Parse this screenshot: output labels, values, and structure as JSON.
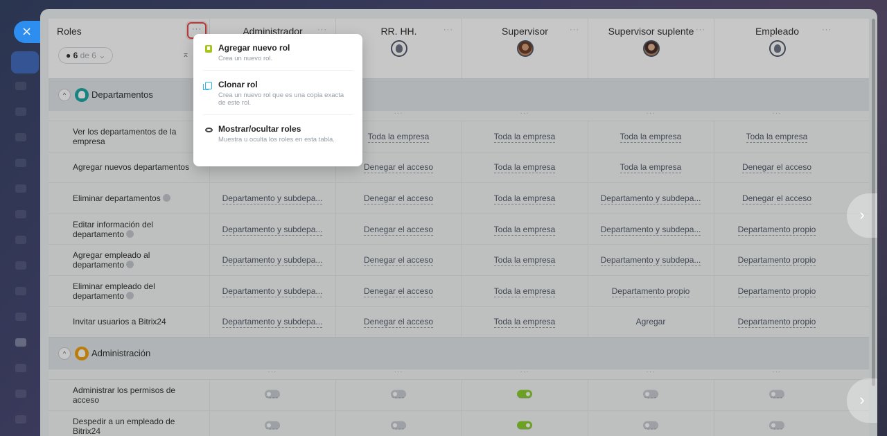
{
  "close_icon_glyph": "×",
  "roles_panel": {
    "title": "Roles",
    "menu_glyph": "···",
    "visible_count": "6",
    "visible_of": "de 6",
    "chevron_glyph": "⌄",
    "collapse_glyph": "⌅"
  },
  "roles": [
    {
      "name": "Administrador",
      "avatar": "none"
    },
    {
      "name": "RR. HH.",
      "avatar": "placeholder"
    },
    {
      "name": "Supervisor",
      "avatar": "photo"
    },
    {
      "name": "Supervisor suplente",
      "avatar": "photo"
    },
    {
      "name": "Empleado",
      "avatar": "group"
    }
  ],
  "role_menu_glyph": "···",
  "sections": [
    {
      "title": "Departamentos",
      "icon": "department-icon",
      "rows": [
        {
          "label": "Ver los departamentos de la empresa",
          "help": false,
          "values": [
            "",
            "Toda la empresa",
            "Toda la empresa",
            "Toda la empresa",
            "Toda la empresa"
          ]
        },
        {
          "label": "Agregar nuevos departamentos",
          "help": false,
          "values": [
            "",
            "Denegar el acceso",
            "Toda la empresa",
            "Toda la empresa",
            "Denegar el acceso"
          ]
        },
        {
          "label": "Eliminar departamentos",
          "help": true,
          "values": [
            "Departamento y subdepa...",
            "Denegar el acceso",
            "Toda la empresa",
            "Departamento y subdepa...",
            "Denegar el acceso"
          ]
        },
        {
          "label": "Editar información del departamento",
          "help": true,
          "values": [
            "Departamento y subdepa...",
            "Denegar el acceso",
            "Toda la empresa",
            "Departamento y subdepa...",
            "Departamento propio"
          ]
        },
        {
          "label": "Agregar empleado al departamento",
          "help": true,
          "values": [
            "Departamento y subdepa...",
            "Denegar el acceso",
            "Toda la empresa",
            "Departamento y subdepa...",
            "Departamento propio"
          ]
        },
        {
          "label": "Eliminar empleado del departamento",
          "help": true,
          "values": [
            "Departamento y subdepa...",
            "Denegar el acceso",
            "Toda la empresa",
            "Departamento propio",
            "Departamento propio"
          ]
        },
        {
          "label": "Invitar usuarios a Bitrix24",
          "help": false,
          "values": [
            "Departamento y subdepa...",
            "Denegar el acceso",
            "Toda la empresa",
            "Agregar",
            "Departamento propio"
          ]
        }
      ]
    },
    {
      "title": "Administración",
      "icon": "admin-icon",
      "rows": [
        {
          "label": "Administrar los permisos de acceso",
          "help": false,
          "toggles": [
            false,
            false,
            true,
            false,
            false
          ]
        },
        {
          "label": "Despedir a un empleado de Bitrix24",
          "help": false,
          "toggles": [
            false,
            false,
            true,
            false,
            false
          ]
        }
      ]
    }
  ],
  "next_arrow_glyph": "›",
  "popup": {
    "items": [
      {
        "title": "Agregar nuevo rol",
        "desc": "Crea un nuevo rol.",
        "icon": "book-icon"
      },
      {
        "title": "Clonar rol",
        "desc": "Crea un nuevo rol que es una copia exacta de este rol.",
        "icon": "copy-icon"
      },
      {
        "title": "Mostrar/ocultar roles",
        "desc": "Muestra u oculta los roles en esta tabla.",
        "icon": "eye-icon"
      }
    ]
  }
}
